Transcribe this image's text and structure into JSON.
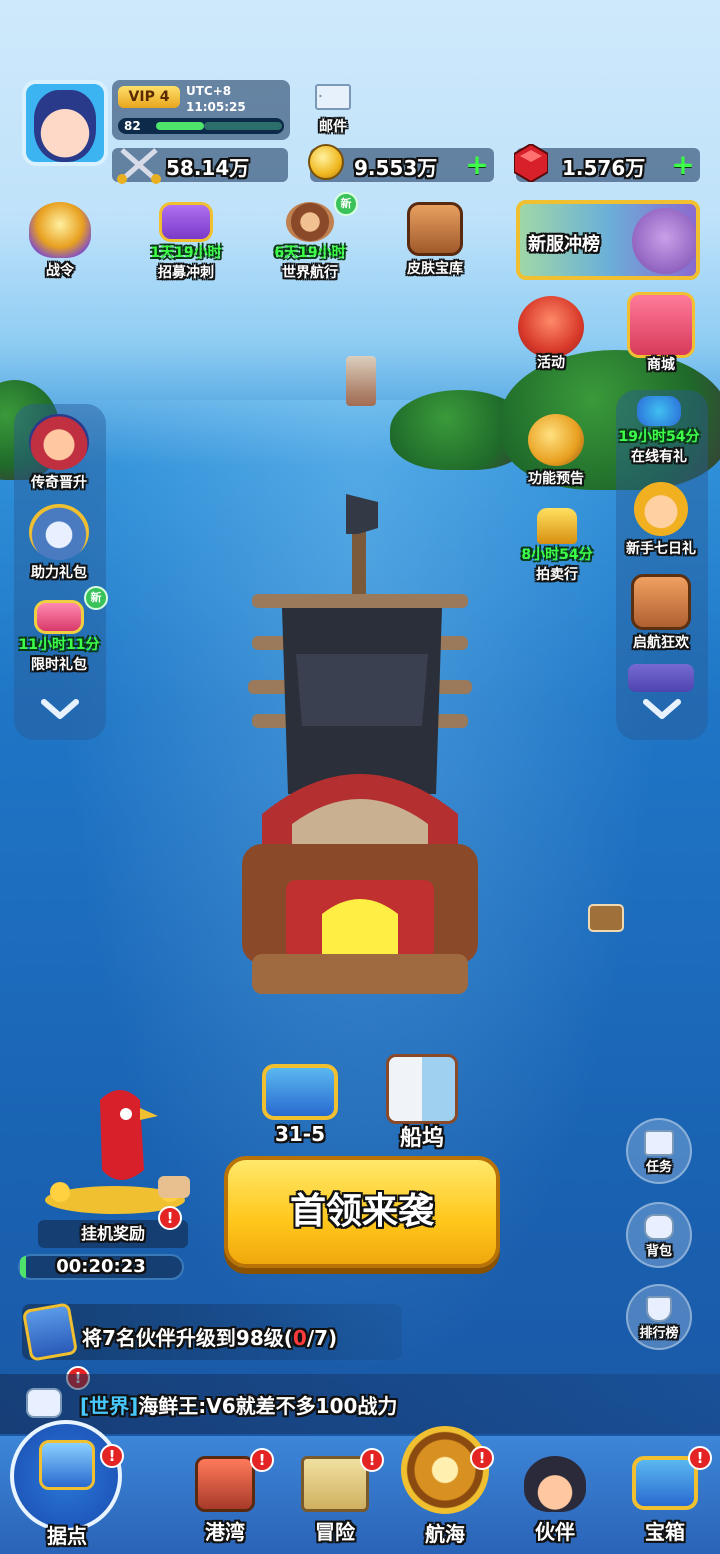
{
  "player": {
    "vip": "VIP 4",
    "utc": "UTC+8",
    "time": "11:05:25",
    "level": "82",
    "power": "58.14万"
  },
  "mail": {
    "label": "邮件"
  },
  "currency": {
    "gold": "9.553万",
    "gems": "1.576万"
  },
  "top_icons": [
    {
      "label": "战令",
      "timer": ""
    },
    {
      "label": "招募冲刺",
      "timer": "1天19小时"
    },
    {
      "label": "世界航行",
      "timer": "6天19小时",
      "badge": "新"
    },
    {
      "label": "皮肤宝库",
      "timer": ""
    }
  ],
  "banner": {
    "label": "新服冲榜"
  },
  "right_icons": [
    {
      "label": "活动",
      "timer": ""
    },
    {
      "label": "商城",
      "timer": ""
    },
    {
      "label": "在线有礼",
      "timer": "19小时54分"
    },
    {
      "label": "功能预告",
      "timer": ""
    },
    {
      "label": "新手七日礼",
      "timer": ""
    },
    {
      "label": "拍卖行",
      "timer": "8小时54分"
    },
    {
      "label": "启航狂欢",
      "timer": ""
    }
  ],
  "left_icons": [
    {
      "label": "传奇晋升",
      "timer": ""
    },
    {
      "label": "助力礼包",
      "timer": ""
    },
    {
      "label": "限时礼包",
      "timer": "11小时11分",
      "badge": "新"
    }
  ],
  "stage": {
    "label": "31-5"
  },
  "dock": {
    "label": "船坞"
  },
  "idle": {
    "label": "挂机奖励",
    "timer": "00:20:23"
  },
  "boss_button": {
    "label": "首领来袭"
  },
  "side_buttons": [
    {
      "label": "任务"
    },
    {
      "label": "背包"
    },
    {
      "label": "排行榜"
    }
  ],
  "quest": {
    "text": "将7名伙伴升级到98级(",
    "progress_current": "0",
    "progress_total": "/7)"
  },
  "chat": {
    "channel": "[世界]",
    "message": "海鲜王:V6就差不多100战力"
  },
  "alert_mark": "!",
  "nav": [
    {
      "label": "据点"
    },
    {
      "label": "港湾"
    },
    {
      "label": "冒险"
    },
    {
      "label": "航海"
    },
    {
      "label": "伙伴"
    },
    {
      "label": "宝箱"
    }
  ],
  "colors": {
    "timer_green": "#3dff4a",
    "quest_red": "#ff3b3b",
    "chat_channel": "#47c9ff",
    "boss_button": "#ffc61a"
  }
}
